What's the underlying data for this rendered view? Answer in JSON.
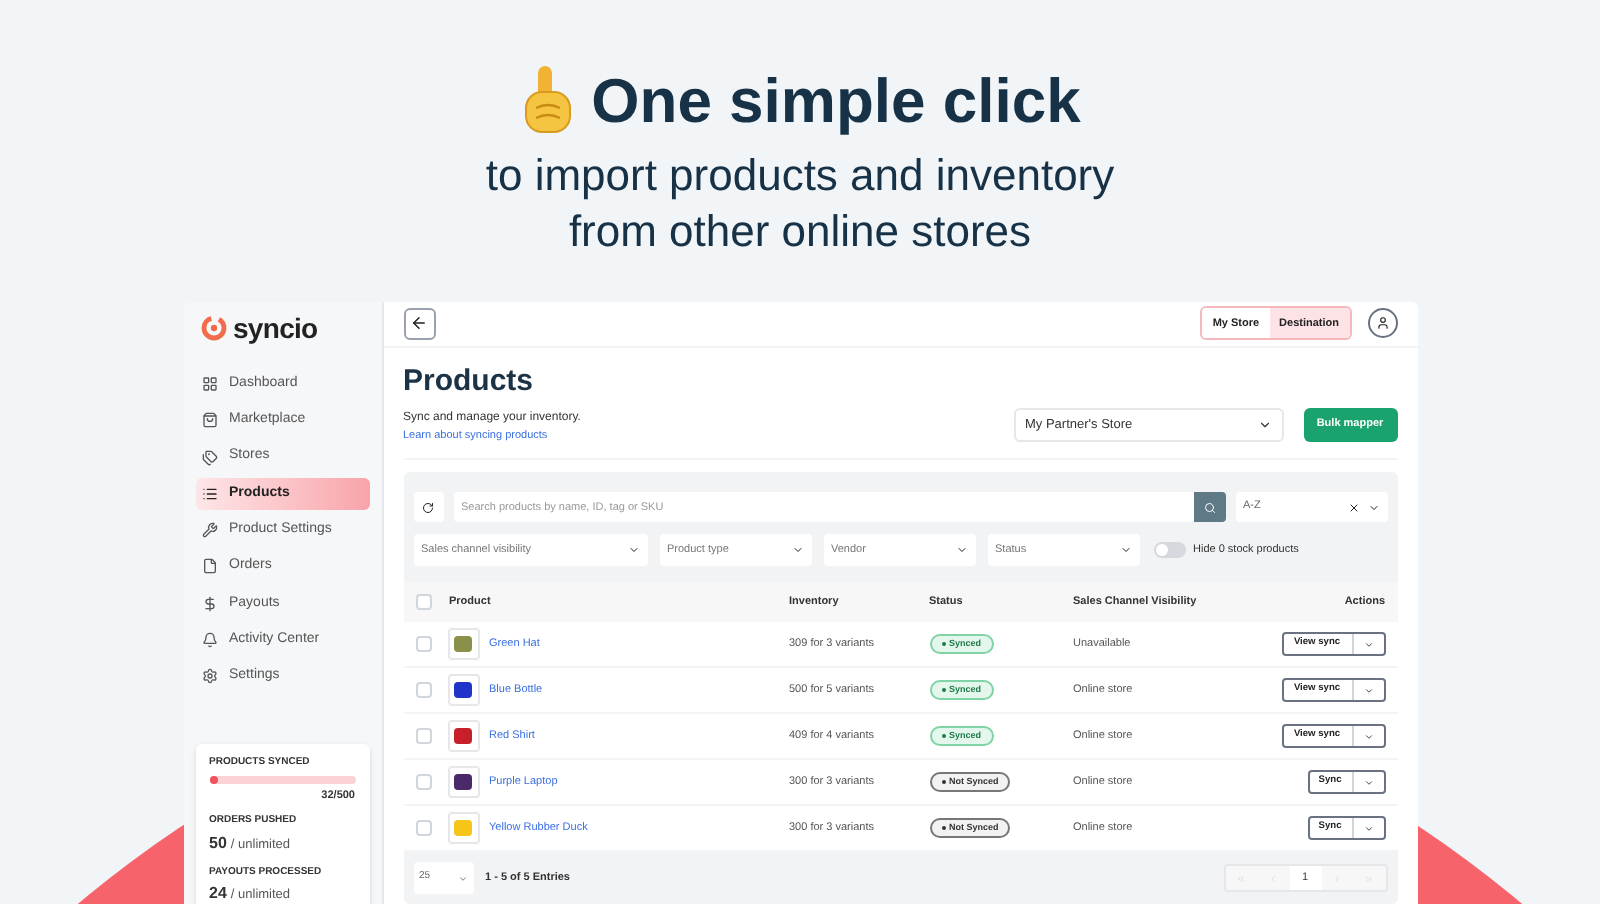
{
  "headline": {
    "title": "One simple click",
    "subtitle": "to import products and inventory from other online stores"
  },
  "app": {
    "logo": "syncio",
    "sidebar": {
      "items": [
        {
          "label": "Dashboard",
          "selected": false
        },
        {
          "label": "Marketplace",
          "selected": false
        },
        {
          "label": "Stores",
          "selected": false
        },
        {
          "label": "Products",
          "selected": true
        },
        {
          "label": "Product Settings",
          "selected": false
        },
        {
          "label": "Orders",
          "selected": false
        },
        {
          "label": "Payouts",
          "selected": false
        },
        {
          "label": "Activity Center",
          "selected": false
        },
        {
          "label": "Settings",
          "selected": false
        }
      ],
      "stats": [
        {
          "kind": "meter",
          "label": "PRODUCTS SYNCED",
          "level": 0.064,
          "reading": "32/500"
        },
        {
          "kind": "count",
          "label": "ORDERS PUSHED",
          "value": "50",
          "limit": "/ unlimited"
        },
        {
          "kind": "count",
          "label": "PAYOUTS PROCESSED",
          "value": "24",
          "limit": "/ unlimited"
        }
      ]
    },
    "store_toggle": [
      {
        "label": "My Store",
        "selected": false
      },
      {
        "label": "Destination",
        "selected": true
      }
    ],
    "page": {
      "title": "Products",
      "description": "Sync and manage your inventory.",
      "link": "Learn about syncing products",
      "store_select": "My Partner's Store",
      "primary_button": "Bulk mapper"
    },
    "search": {
      "placeholder": "Search products by name, ID, tag or SKU"
    },
    "sort": {
      "value": "A-Z"
    },
    "filters": [
      {
        "placeholder": "Sales channel visibility"
      },
      {
        "placeholder": "Product type"
      },
      {
        "placeholder": "Vendor"
      },
      {
        "placeholder": "Status"
      }
    ],
    "hide_zero_stock": {
      "label": "Hide 0 stock products",
      "on": false
    },
    "table": {
      "select_all_checked": false,
      "columns": [
        "Product",
        "Inventory",
        "Status",
        "Sales Channel Visibility",
        "Actions"
      ],
      "rows": [
        {
          "product": "Green Hat",
          "checked": false,
          "inventory": "309 for 3 variants",
          "status": {
            "kind": "synced",
            "label": "Synced"
          },
          "visibility": "Unavailable",
          "action": "View sync"
        },
        {
          "product": "Blue Bottle",
          "checked": false,
          "inventory": "500 for 5 variants",
          "status": {
            "kind": "synced",
            "label": "Synced"
          },
          "visibility": "Online store",
          "action": "View sync"
        },
        {
          "product": "Red Shirt",
          "checked": false,
          "inventory": "409 for 4 variants",
          "status": {
            "kind": "synced",
            "label": "Synced"
          },
          "visibility": "Online store",
          "action": "View sync"
        },
        {
          "product": "Purple Laptop",
          "checked": false,
          "inventory": "300 for 3 variants",
          "status": {
            "kind": "not_synced",
            "label": "Not Synced"
          },
          "visibility": "Online store",
          "action": "Sync"
        },
        {
          "product": "Yellow Rubber Duck",
          "checked": false,
          "inventory": "300 for 3 variants",
          "status": {
            "kind": "not_synced",
            "label": "Not Synced"
          },
          "visibility": "Online store",
          "action": "Sync"
        }
      ]
    },
    "footer": {
      "page_size": "25",
      "entries": "1 - 5 of 5 Entries",
      "pages": [
        {
          "label": "1",
          "selected": true
        }
      ]
    }
  }
}
